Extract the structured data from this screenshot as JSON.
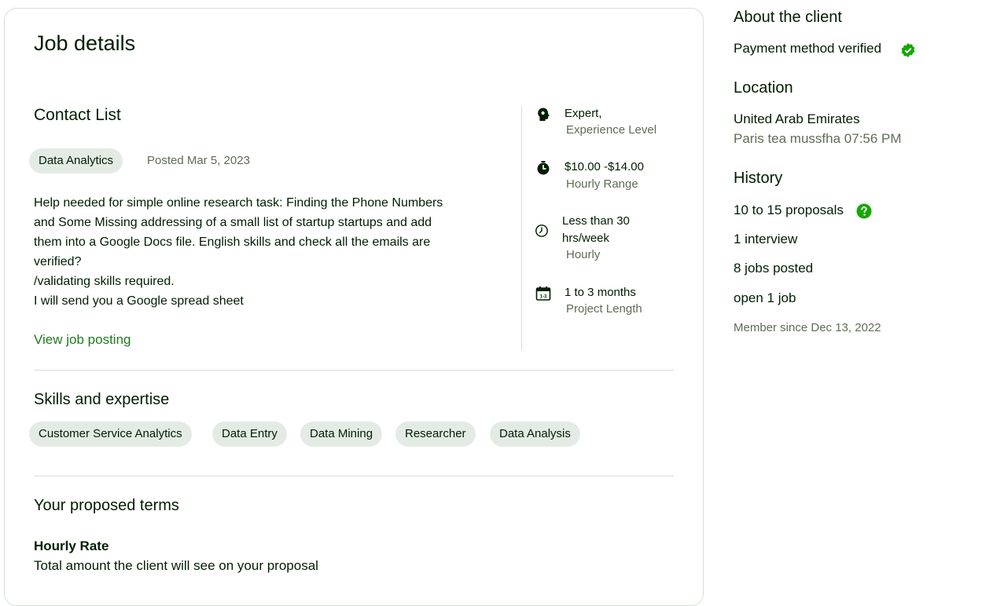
{
  "job": {
    "title": "Job details",
    "name": "Contact List",
    "category": "Data Analytics",
    "posted": "Posted Mar 5, 2023",
    "description": [
      "Help needed for simple online research task: Finding the Phone Numbers",
      "and Some Missing addressing of a small list of startup startups and add",
      "them into a Google Docs file. English skills and check all the emails are",
      "verified?",
      "/validating skills required.",
      "I will send you a Google spread sheet"
    ],
    "view_link": "View job posting"
  },
  "details": [
    {
      "icon": "expert-head-icon",
      "value": "Expert,",
      "label": "Experience Level"
    },
    {
      "icon": "stopwatch-icon",
      "value": "$10.00 -$14.00",
      "label": "Hourly Range"
    },
    {
      "icon": "clock-icon",
      "value_line1": "Less than 30",
      "value_line2": "hrs/week",
      "label": "Hourly"
    },
    {
      "icon": "calendar-icon",
      "value": "1 to 3 months",
      "label": "Project Length"
    }
  ],
  "skills": {
    "title": "Skills and expertise",
    "items": [
      "Customer Service Analytics",
      "Data Entry",
      "Data Mining",
      "Researcher",
      "Data Analysis"
    ]
  },
  "terms": {
    "title": "Your proposed terms",
    "rate_label": "Hourly Rate",
    "rate_desc": "Total amount the client will see on your proposal"
  },
  "client": {
    "title": "About the client",
    "payment": "Payment method verified",
    "location_title": "Location",
    "country": "United Arab Emirates",
    "city_time": "Paris tea mussfha 07:56 PM",
    "history_title": "History",
    "proposals": "10 to 15 proposals",
    "interviews": "1 interview",
    "jobs_posted": "8 jobs posted",
    "open_jobs": "open 1 job",
    "member_since": "Member since Dec 13, 2022"
  },
  "colors": {
    "accent": "#14a800",
    "link": "#1f7a1f",
    "chip_bg": "#e4ebe4",
    "text": "#001e00",
    "muted": "#5e6d55",
    "border": "#d5e0d5"
  }
}
